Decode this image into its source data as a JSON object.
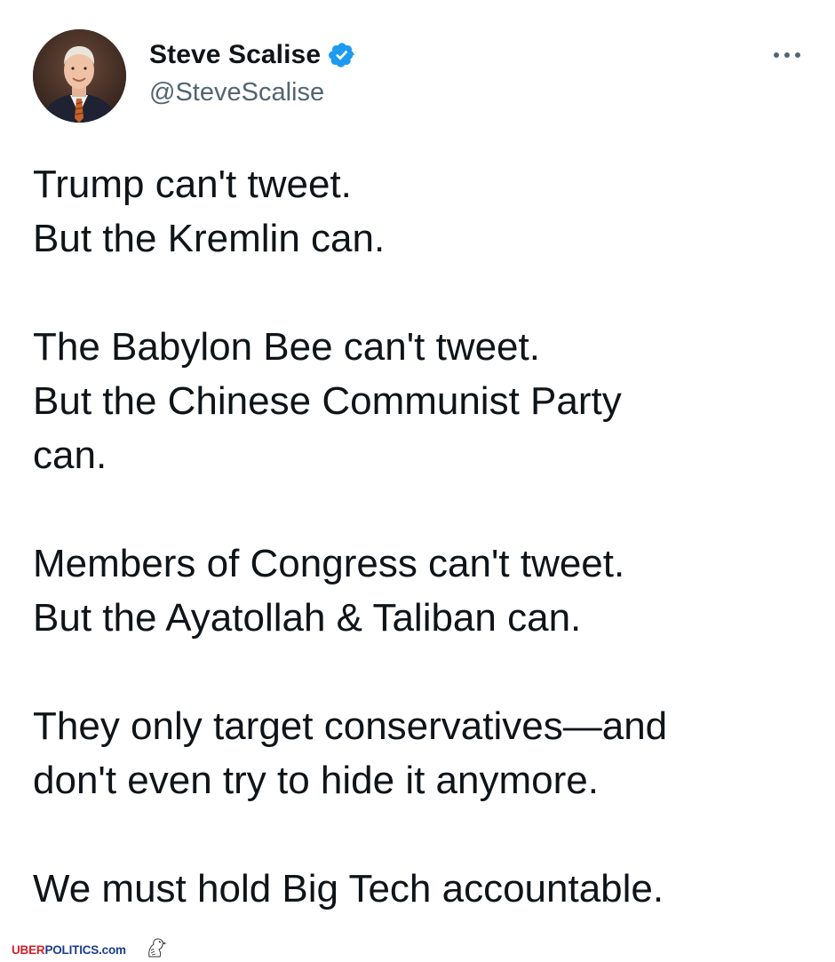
{
  "author": {
    "display_name": "Steve Scalise",
    "handle": "@SteveScalise",
    "verified": true,
    "verified_badge_color": "#1d9bf0",
    "avatar_icon": "profile-photo"
  },
  "menu": {
    "more_icon": "more-horizontal-icon"
  },
  "tweet": {
    "paragraphs": [
      {
        "lines": [
          "Trump can't tweet.",
          "But the Kremlin can."
        ]
      },
      {
        "lines": [
          "The Babylon Bee can't tweet.",
          "But the Chinese Communist Party",
          "can."
        ]
      },
      {
        "lines": [
          "Members of Congress can't tweet.",
          "But the Ayatollah & Taliban can."
        ]
      },
      {
        "lines": [
          "They only target conservatives—and",
          "don't even try to hide it anymore."
        ]
      },
      {
        "lines": [
          "We must hold Big Tech accountable."
        ]
      }
    ]
  },
  "watermark": {
    "part1": "UBER",
    "part2": "POLITICS",
    "part3": ".com",
    "color_red": "#d3202a",
    "color_blue": "#1a3c8f",
    "icon": "eagle-icon"
  },
  "colors": {
    "text_primary": "#0f1419",
    "text_secondary": "#536471",
    "background": "#ffffff"
  }
}
